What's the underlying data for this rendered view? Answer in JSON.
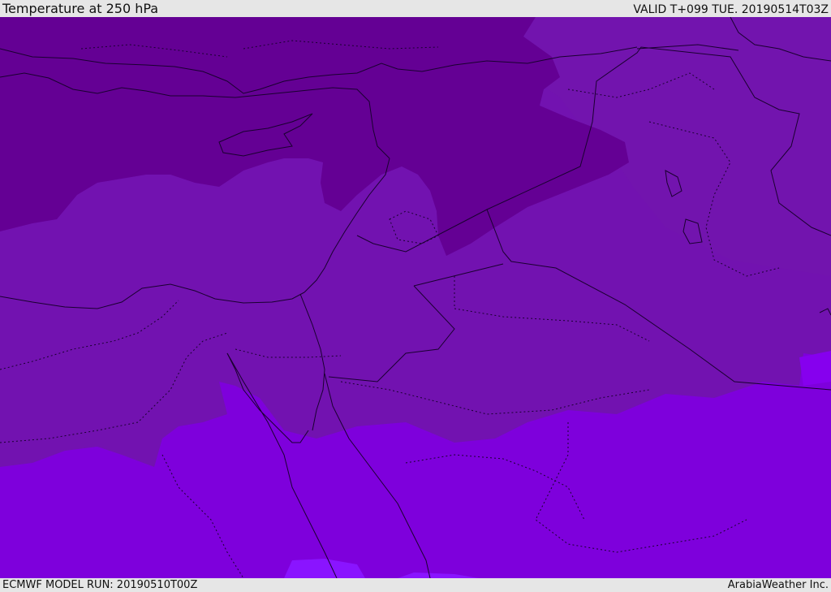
{
  "header": {
    "title": "Temperature at 250 hPa",
    "valid_time": "VALID T+099 TUE. 20190514T03Z"
  },
  "footer": {
    "model_run": "ECMWF MODEL RUN: 20190510T00Z",
    "credit": "ArabiaWeather Inc."
  },
  "colors": {
    "band_darkest": "#640094",
    "band_dark": "#7214ae",
    "band_mid": "#7212b0",
    "band_light": "#7e00dc",
    "band_bright": "#8600ee",
    "band_brightest": "#8a14ff",
    "coastline": "#1a0030"
  }
}
